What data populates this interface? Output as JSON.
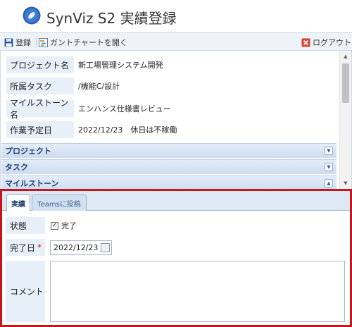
{
  "app": {
    "title": "SynViz S2 実績登録",
    "logo_icon": "synviz-logo-icon"
  },
  "toolbar": {
    "register_label": "登録",
    "gantt_label": "ガントチャートを開く",
    "logout_label": "ログアウト",
    "register_icon": "save-icon",
    "gantt_icon": "gantt-chart-icon",
    "logout_icon": "logout-icon"
  },
  "fields": [
    {
      "label": "プロジェクト名",
      "value": "新工場管理システム開発"
    },
    {
      "label": "所属タスク",
      "value": "/機能C/設計"
    },
    {
      "label": "マイルストーン名",
      "value": "エンハンス仕様書レビュー"
    },
    {
      "label": "作業予定日",
      "value": "2022/12/23　休日は不稼働"
    }
  ],
  "sections": [
    {
      "label": "プロジェクト",
      "state": "collapsed"
    },
    {
      "label": "タスク",
      "state": "collapsed"
    },
    {
      "label": "マイルストーン",
      "state": "expanded"
    }
  ],
  "tabs": [
    {
      "label": "実績",
      "active": true
    },
    {
      "label": "Teamsに投稿",
      "active": false
    }
  ],
  "form": {
    "status_label": "状態",
    "status_checkbox_label": "完了",
    "status_checked": true,
    "date_label": "完了日",
    "date_required_mark": "*",
    "date_value": "2022/12/23",
    "comment_label": "コメント",
    "comment_value": ""
  },
  "colors": {
    "highlight_border": "#c9141c",
    "label_bg": "#e7eff9",
    "section_bar": "#cddcf0"
  }
}
